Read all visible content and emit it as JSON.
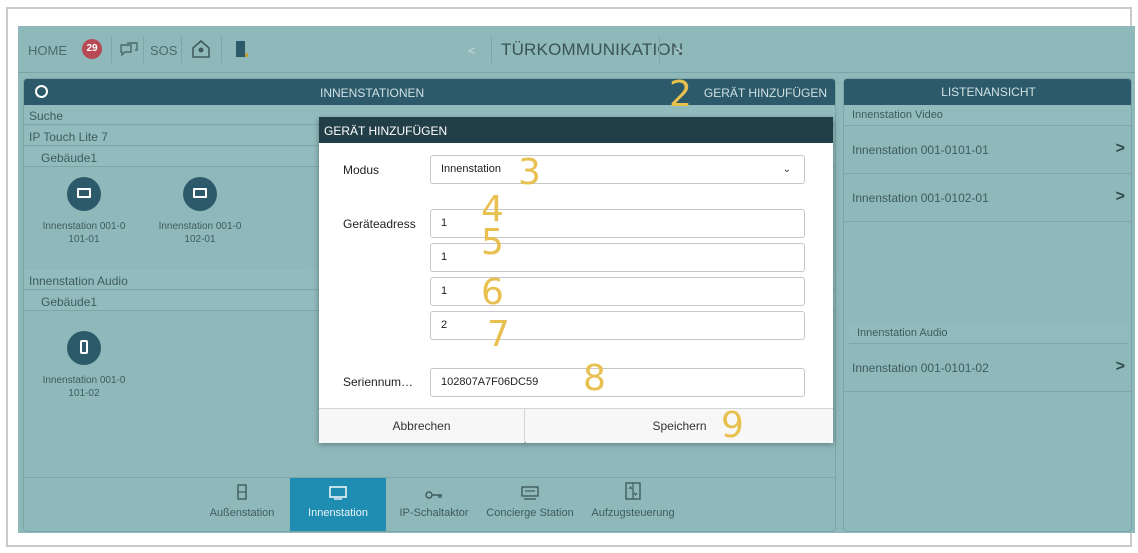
{
  "topbar": {
    "home_label": "HOME",
    "badge_count": "29",
    "sos_label": "SOS",
    "prev_arrow": "<",
    "next_arrow": ">",
    "title": "TÜRKOMMUNIKATION"
  },
  "panel": {
    "title": "INNENSTATIONEN",
    "add_label": "GERÄT HINZUFÜGEN",
    "search_label": "Suche",
    "groups": [
      {
        "name": "IP Touch Lite 7",
        "building": "Gebäude1",
        "devices": [
          {
            "label": "Innenstation 001-0 101-01",
            "icon": "monitor-icon"
          },
          {
            "label": "Innenstation 001-0 102-01",
            "icon": "monitor-icon"
          }
        ]
      },
      {
        "name": "Innenstation Audio",
        "building": "Gebäude1",
        "devices": [
          {
            "label": "Innenstation 001-0 101-02",
            "icon": "handset-icon"
          }
        ]
      }
    ]
  },
  "tabs": [
    {
      "label": "Außenstation",
      "icon": "outdoor-station-icon",
      "active": false
    },
    {
      "label": "Innenstation",
      "icon": "indoor-station-icon",
      "active": true
    },
    {
      "label": "IP-Schaltaktor",
      "icon": "key-icon",
      "active": false
    },
    {
      "label": "Concierge Station",
      "icon": "concierge-icon",
      "active": false
    },
    {
      "label": "Aufzugsteuerung",
      "icon": "elevator-icon",
      "active": false
    }
  ],
  "right_panel": {
    "title": "LISTENANSICHT",
    "video_section": "Innenstation Video",
    "video_items": [
      "Innenstation 001-0101-01",
      "Innenstation 001-0102-01"
    ],
    "audio_section": "Innenstation Audio",
    "audio_items": [
      "Innenstation 001-0101-02"
    ]
  },
  "dialog": {
    "title": "GERÄT HINZUFÜGEN",
    "mode_label": "Modus",
    "mode_value": "Innenstation",
    "address_label": "Geräteadress",
    "address_values": [
      "1",
      "1",
      "1",
      "2"
    ],
    "serial_label": "Seriennum…",
    "serial_value": "102807A7F06DC59",
    "cancel_label": "Abbrechen",
    "save_label": "Speichern"
  },
  "callouts": [
    "2",
    "3",
    "4",
    "5",
    "6",
    "7",
    "8",
    "9"
  ],
  "colors": {
    "background": "#8fb8bb",
    "header_dark": "#2d5a6a",
    "active_tab": "#1f8db1",
    "badge": "#b64a55",
    "callout": "#e8c04f"
  }
}
